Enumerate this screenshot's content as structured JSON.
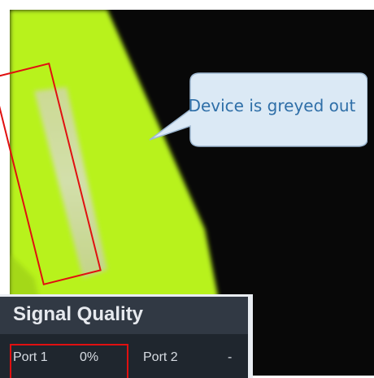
{
  "callout": {
    "text": "Device is greyed out"
  },
  "signal_panel": {
    "title": "Signal Quality",
    "ports": [
      {
        "label": "Port 1",
        "value": "0%"
      },
      {
        "label": "Port 2",
        "value": "-"
      }
    ]
  },
  "colors": {
    "device_green": "#b8f21a",
    "callout_fill": "#dbe9f5",
    "callout_border": "#9fb9d2",
    "callout_text": "#2f6fa8",
    "highlight_red": "#e01010",
    "panel_bg": "#1f262e",
    "panel_header": "#313944"
  }
}
